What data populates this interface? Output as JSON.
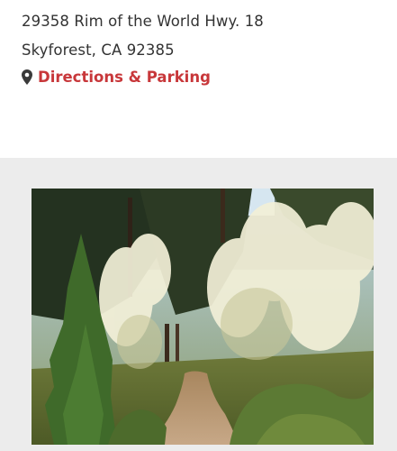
{
  "location": {
    "address_line1": "29358 Rim of the World Hwy. 18",
    "address_line2": "Skyforest, CA 92385",
    "directions_label": "Directions & Parking",
    "directions_icon": "map-pin-icon",
    "accent_color": "#c8373a"
  },
  "gallery": {
    "background_color": "#ececec"
  }
}
